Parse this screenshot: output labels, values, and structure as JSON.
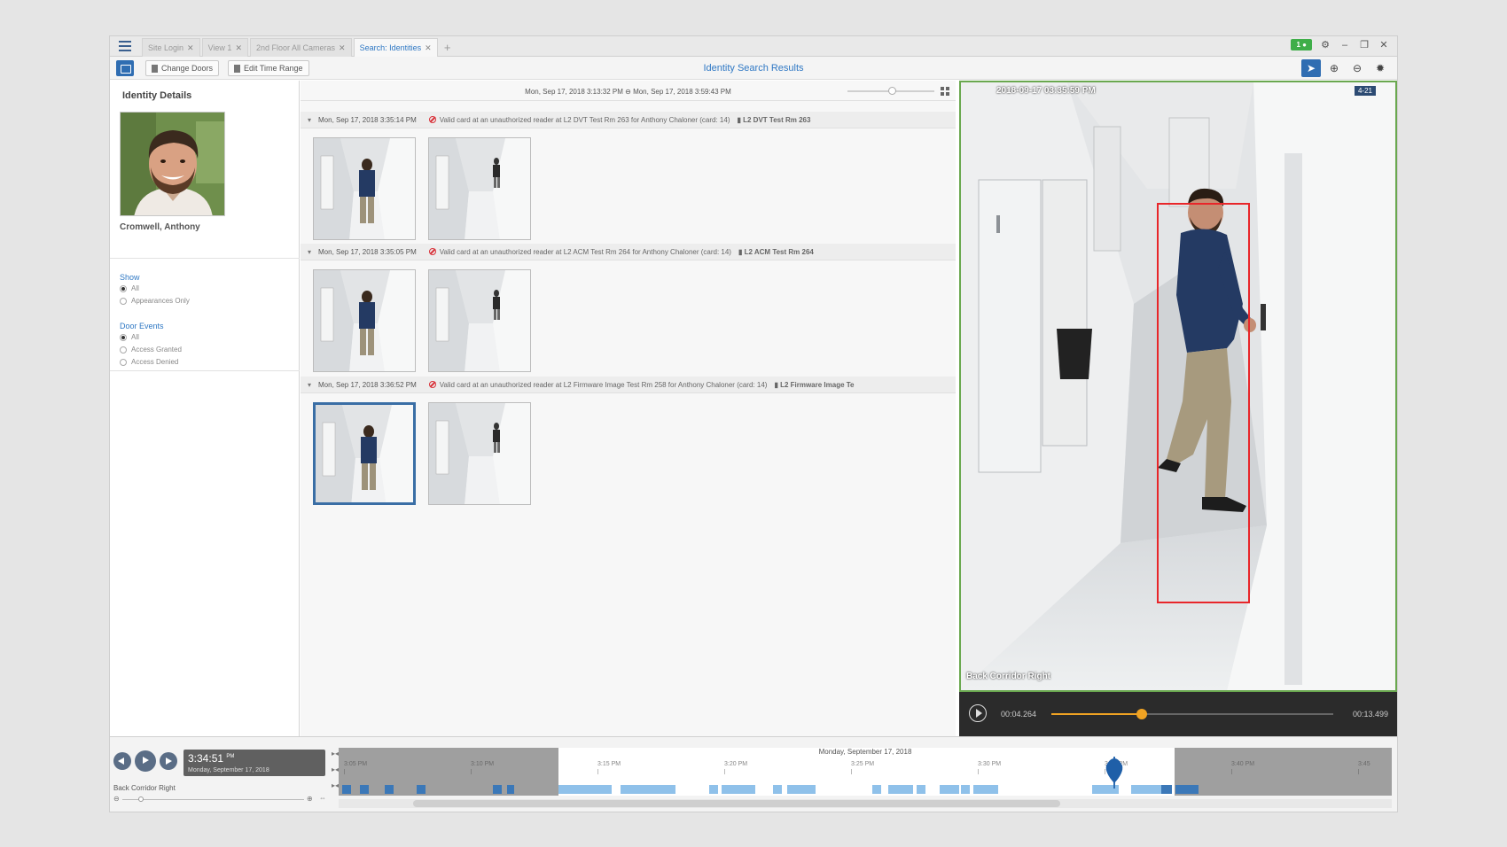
{
  "tabs": [
    {
      "label": "Site Login",
      "active": false
    },
    {
      "label": "View 1",
      "active": false
    },
    {
      "label": "2nd Floor All Cameras",
      "active": false
    },
    {
      "label": "Search: Identities",
      "active": true
    }
  ],
  "window": {
    "badge": "1 ●"
  },
  "toolbar": {
    "change_doors": "Change Doors",
    "edit_time_range": "Edit Time Range",
    "title": "Identity Search Results"
  },
  "identity": {
    "heading": "Identity Details",
    "name": "Cromwell, Anthony"
  },
  "filters": {
    "show_label": "Show",
    "show_options": [
      "All",
      "Appearances Only"
    ],
    "show_selected": 0,
    "door_label": "Door Events",
    "door_options": [
      "All",
      "Access Granted",
      "Access Denied"
    ],
    "door_selected": 0
  },
  "range": {
    "text": "Mon, Sep 17, 2018 3:13:32 PM  ⊖  Mon, Sep 17, 2018 3:59:43 PM",
    "zoom": 0.5
  },
  "events": [
    {
      "timestamp": "Mon, Sep 17, 2018 3:35:14 PM",
      "description": "Valid card at an unauthorized reader at L2 DVT Test Rm 263 for Anthony Chaloner (card: 14)",
      "door": "L2 DVT Test Rm 263"
    },
    {
      "timestamp": "Mon, Sep 17, 2018 3:35:05 PM",
      "description": "Valid card at an unauthorized reader at L2 ACM Test Rm 264 for Anthony Chaloner (card: 14)",
      "door": "L2 ACM Test Rm 264"
    },
    {
      "timestamp": "Mon, Sep 17, 2018 3:36:52 PM",
      "description": "Valid card at an unauthorized reader at L2 Firmware Image Test Rm 258 for Anthony Chaloner (card: 14)",
      "door": "L2 Firmware Image Te"
    }
  ],
  "video": {
    "timestamp": "2018-09-17 03:35:59 PM",
    "tag": "4-21",
    "camera": "Back Corridor Right",
    "current": "00:04.264",
    "duration": "00:13.499",
    "progress": 0.32
  },
  "timeline": {
    "clock_time": "3:34:51",
    "clock_ampm": "PM",
    "clock_date": "Monday, September 17, 2018",
    "camera": "Back Corridor Right",
    "date_header": "Monday, September 17, 2018",
    "ticks": [
      "3:05 PM",
      "3:10 PM",
      "3:15 PM",
      "3:20 PM",
      "3:25 PM",
      "3:30 PM",
      "3:35 PM",
      "3:40 PM",
      "3:45"
    ]
  },
  "colors": {
    "accent": "#2f78c4",
    "deny": "#d9323a",
    "bbox": "#e8262a",
    "video_border": "#6aa84f",
    "progress": "#f0a323"
  }
}
